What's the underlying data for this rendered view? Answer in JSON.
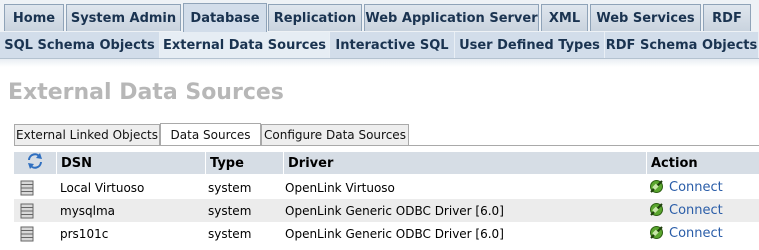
{
  "top_tabs": [
    {
      "label": "Home"
    },
    {
      "label": "System Admin"
    },
    {
      "label": "Database"
    },
    {
      "label": "Replication"
    },
    {
      "label": "Web Application Server"
    },
    {
      "label": "XML"
    },
    {
      "label": "Web Services"
    },
    {
      "label": "RDF"
    }
  ],
  "sub_tabs": [
    {
      "label": "SQL Schema Objects"
    },
    {
      "label": "External Data Sources"
    },
    {
      "label": "Interactive SQL"
    },
    {
      "label": "User Defined Types"
    },
    {
      "label": "RDF Schema Objects"
    }
  ],
  "page": {
    "title": "External Data Sources"
  },
  "inner_tabs": [
    {
      "label": "External Linked Objects"
    },
    {
      "label": "Data Sources"
    },
    {
      "label": "Configure Data Sources"
    }
  ],
  "table": {
    "columns": {
      "dsn": "DSN",
      "type": "Type",
      "driver": "Driver",
      "action": "Action"
    },
    "rows": [
      {
        "dsn": "Local Virtuoso",
        "type": "system",
        "driver": "OpenLink Virtuoso",
        "action": "Connect"
      },
      {
        "dsn": "mysqlma",
        "type": "system",
        "driver": "OpenLink Generic ODBC Driver [6.0]",
        "action": "Connect"
      },
      {
        "dsn": "prs101c",
        "type": "system",
        "driver": "OpenLink Generic ODBC Driver [6.0]",
        "action": "Connect"
      }
    ]
  },
  "icons": {
    "refresh": "refresh-icon",
    "datasource": "database-stack-icon",
    "connect": "plug-icon"
  },
  "colors": {
    "accent": "#1a3350",
    "link": "#2a5da8",
    "header_bg": "#d6dde5",
    "alt_row": "#ececec"
  }
}
